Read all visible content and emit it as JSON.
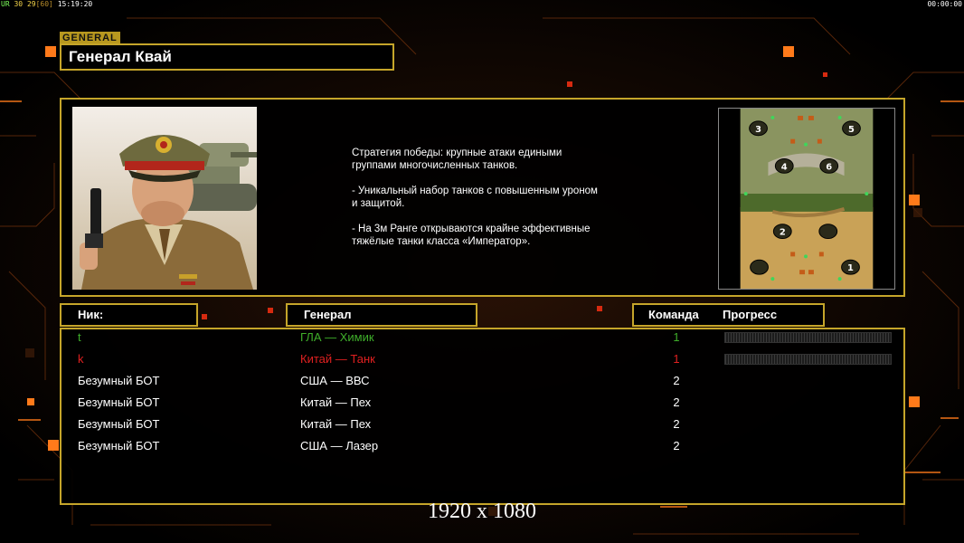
{
  "top_stats": {
    "prefix": "UR",
    "fps": "30",
    "fps_cap": "29",
    "cap_open": "[",
    "cap_value": "60",
    "cap_close": "]",
    "clock": "15:19:20",
    "timer": "00:00:00"
  },
  "general": {
    "tag": "GENERAL",
    "name": "Генерал Квай"
  },
  "strategy": {
    "text": "Стратегия победы: крупные атаки едиными\n группами многочисленных танков.\n\n- Уникальный набор танков с повышенным уроном\n и защитой.\n\n- На 3м Ранге открываются крайне эффективные\n тяжёлые танки класса «Император»."
  },
  "map_icon": "map-minimap",
  "map_slots": [
    "1",
    "2",
    "3",
    "4",
    "5",
    "6"
  ],
  "headers": {
    "nick": "Ник:",
    "general": "Генерал",
    "team": "Команда",
    "progress": "Прогресс"
  },
  "players": [
    {
      "nick": "t",
      "general": "ГЛА — Химик",
      "team": "1",
      "color": "#3fae2a",
      "progress": 0
    },
    {
      "nick": "k",
      "general": "Китай — Танк",
      "team": "1",
      "color": "#e02020",
      "progress": 0
    },
    {
      "nick": "Безумный БОТ",
      "general": "США — ВВС",
      "team": "2",
      "color": "#ffffff"
    },
    {
      "nick": "Безумный БОТ",
      "general": "Китай — Пех",
      "team": "2",
      "color": "#ffffff"
    },
    {
      "nick": "Безумный БОТ",
      "general": "Китай — Пех",
      "team": "2",
      "color": "#ffffff"
    },
    {
      "nick": "Безумный БОТ",
      "general": "США — Лазер",
      "team": "2",
      "color": "#ffffff"
    }
  ],
  "resolution_label": "1920 x 1080",
  "colors": {
    "frame": "#c5a52a",
    "accent_orange": "#ff7a1a",
    "bg_line": "#5a2a0a"
  }
}
